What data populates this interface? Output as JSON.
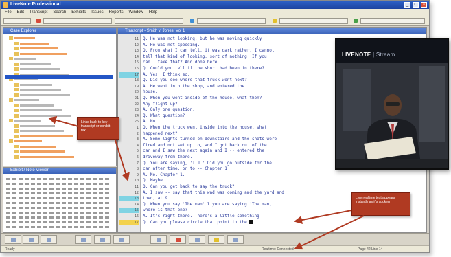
{
  "window": {
    "title": "LiveNote Professional"
  },
  "panels": {
    "case_tree_title": "Case Explorer",
    "hex_panel_title": "Exhibit / Note Viewer",
    "transcript_title": "Transcript - Smith v. Jones, Vol 1"
  },
  "transcript": {
    "line_numbers": [
      "11",
      "12",
      "13",
      "14",
      "15",
      "16",
      "17",
      "18",
      "19",
      "20",
      "21",
      "22",
      "23",
      "24",
      "25",
      "1",
      "2",
      "3",
      "4",
      "5",
      "6",
      "7",
      "8",
      "9",
      "10",
      "11",
      "12",
      "13",
      "14",
      "15",
      "16",
      "17",
      "18",
      "19",
      "20",
      "21",
      "22",
      "23",
      "24",
      "25",
      "1",
      "2",
      "3",
      "4",
      "5",
      "6",
      "7",
      "8",
      "9",
      "10",
      "11",
      "12",
      "13",
      "14",
      "15"
    ],
    "lines": [
      "Q.  He was not looking, but he was moving quickly",
      "A.  He was not speeding.",
      "Q.  From what I can tell, it was dark rather.  I cannot",
      "tell that kind of looking, sort of nothing.  If you",
      "can I take that?  And done here.",
      "Q.  Could you tell if the short had been in there?",
      "A.  Yes.  I think so.",
      "Q.  Did you see where that truck went next?",
      "A.  He went into the shop, and entered the",
      "house.",
      "Q.  When you went inside of the house, what then?",
      "Any flight up?",
      "A.  Only one question.",
      "Q.  What question?",
      "A.  No.",
      "Q.  When the truck went inside into the house, what",
      "happened next?",
      "A.  Some lights turned on downstairs and the shots were",
      "fired and not set up to, and I got back out of the",
      "car and I saw the next again and I -- entered the",
      "driveway from there.",
      "Q.  You are saying, 'I.J.'  Did you go outside for the",
      "car after time, or to -- Chapter 1",
      "A.  No.  Chapter 1.",
      "Q.  Maybe.",
      "Q.  Can you get back to say the truck?",
      "A.  I saw -- say that this wad was coming and the yard and",
      "then, at 9.",
      "Q.  When you say 'The man' I you are saying 'The man,'",
      "where is that one?",
      "A.  It's right there.  There's a little something",
      "Q.  Can you please circle that point in the"
    ]
  },
  "video": {
    "logo_brand": "LIVENOTE",
    "logo_product": "Stream"
  },
  "callouts": {
    "left": "Links back to key transcript or exhibit text",
    "right": "Live realtime text appears instantly as it's spoken"
  },
  "toolbar": {
    "items": [
      "Transcripts",
      "Clips",
      "Exhibits",
      "Issues",
      "Annotations",
      "Reports"
    ]
  },
  "menu": [
    "File",
    "Edit",
    "Transcript",
    "Search",
    "Exhibits",
    "Issues",
    "Reports",
    "Window",
    "Help"
  ],
  "status": {
    "left": "Ready",
    "middle": "Realtime: Connected",
    "right": "Page 42 Line 14"
  },
  "colors": {
    "titlebar": "#2456c6",
    "transcript_text": "#27389a",
    "callout": "#b03a22"
  }
}
